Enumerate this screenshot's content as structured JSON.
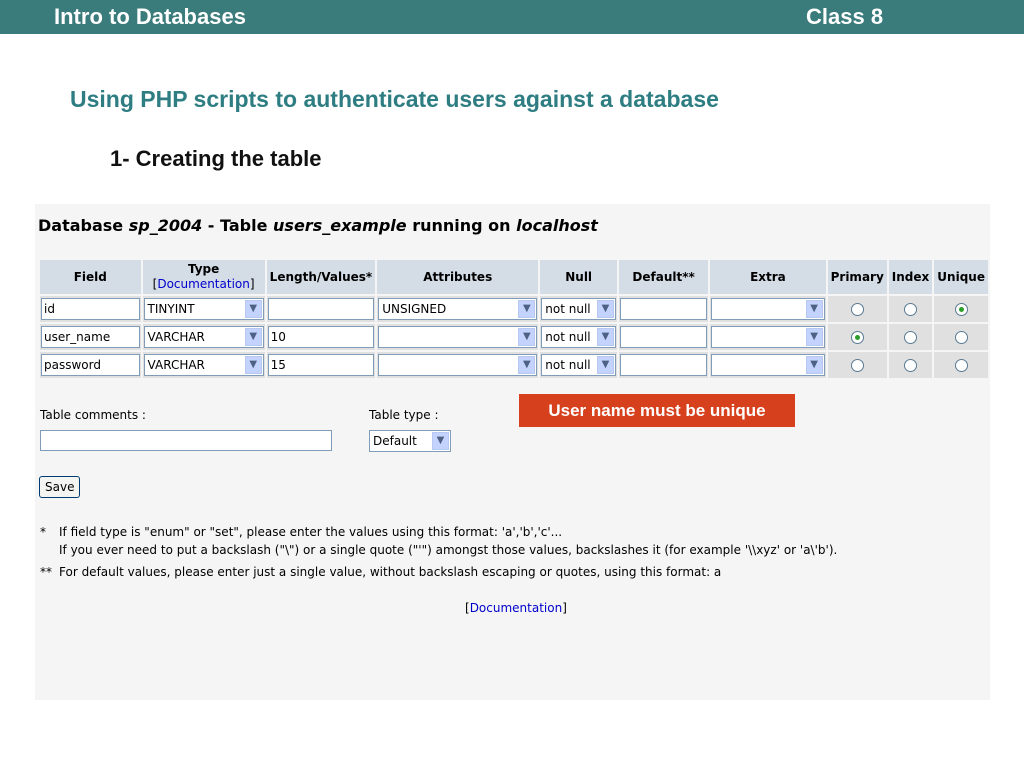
{
  "slide": {
    "header_left": "Intro to Databases",
    "header_right": "Class 8",
    "title": "Using PHP scripts to authenticate users against a database",
    "subtitle": "1- Creating the table"
  },
  "db_header": {
    "prefix": "Database ",
    "db_name": "sp_2004",
    "middle": " - Table ",
    "table_name": "users_example",
    "running": " running on ",
    "host": "localhost"
  },
  "columns": {
    "field": "Field",
    "type": "Type",
    "type_doc_open": "[",
    "type_doc_link": "Documentation",
    "type_doc_close": "]",
    "length": "Length/Values*",
    "attributes": "Attributes",
    "null": "Null",
    "default": "Default**",
    "extra": "Extra",
    "primary": "Primary",
    "index": "Index",
    "unique": "Unique"
  },
  "rows": [
    {
      "field": "id",
      "type": "TINYINT",
      "length": "",
      "attributes": "UNSIGNED",
      "null": "not null",
      "default": "",
      "extra": "",
      "key": "unique"
    },
    {
      "field": "user_name",
      "type": "VARCHAR",
      "length": "10",
      "attributes": "",
      "null": "not null",
      "default": "",
      "extra": "",
      "key": "primary"
    },
    {
      "field": "password",
      "type": "VARCHAR",
      "length": "15",
      "attributes": "",
      "null": "not null",
      "default": "",
      "extra": "",
      "key": "none"
    }
  ],
  "table_comments_label": "Table comments :",
  "table_comments_value": "",
  "table_type_label": "Table type :",
  "table_type_value": "Default",
  "save_label": "Save",
  "callout": "User name must be unique",
  "notes": {
    "star1_mark": "*",
    "star1_line1": "If field type is \"enum\" or \"set\", please enter the values using this format: 'a','b','c'...",
    "star1_line2": "If you ever need to put a backslash (\"\\\") or a single quote (\"'\") amongst those values, backslashes it (for example '\\\\xyz' or 'a\\'b').",
    "star2_mark": "**",
    "star2_line": "For default values, please enter just a single value, without backslash escaping or quotes, using this format: a"
  },
  "footer_doc": {
    "open": "[",
    "link": "Documentation",
    "close": "]"
  },
  "colors": {
    "header_bar": "#3a7b7b",
    "title": "#2e7d82",
    "callout": "#d7401c",
    "th_bg": "#d4dce6",
    "cell_bg": "#e0e0e0"
  }
}
